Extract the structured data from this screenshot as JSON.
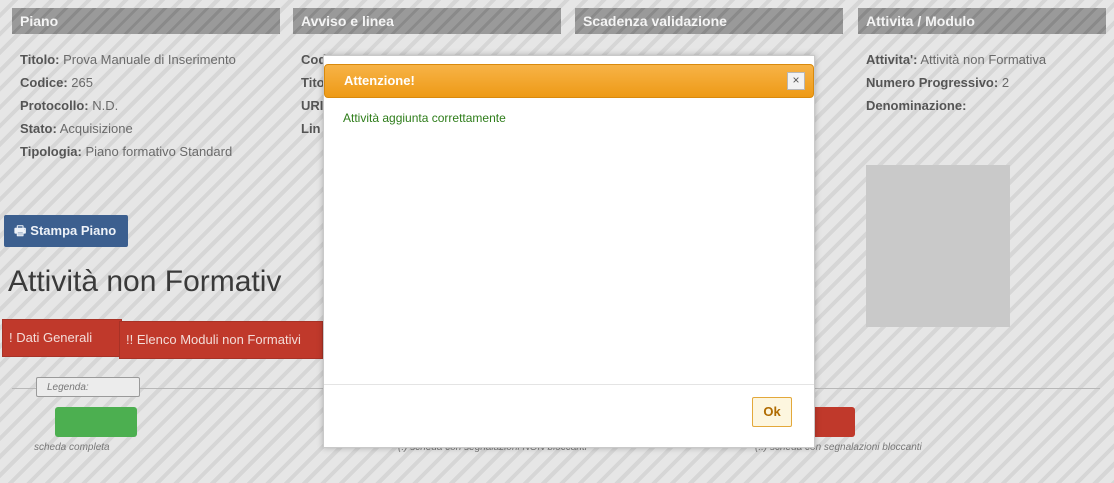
{
  "columns": [
    {
      "title": "Piano",
      "rows": [
        {
          "label": "Titolo:",
          "value": "Prova Manuale di Inserimento"
        },
        {
          "label": "Codice:",
          "value": "265"
        },
        {
          "label": "Protocollo:",
          "value": "N.D."
        },
        {
          "label": "Stato:",
          "value": "Acquisizione"
        },
        {
          "label": "Tipologia:",
          "value": "Piano formativo Standard"
        }
      ]
    },
    {
      "title": "Avviso e linea",
      "rows": [
        {
          "label": "Cod",
          "value": ""
        },
        {
          "label": "Tito",
          "value": ""
        },
        {
          "label": "URI",
          "value": ""
        },
        {
          "label": "Lin",
          "value": ""
        }
      ]
    },
    {
      "title": "Scadenza validazione",
      "rows": []
    },
    {
      "title": "Attivita / Modulo",
      "rows": [
        {
          "label": "Attivita':",
          "value": "Attività non Formativa"
        },
        {
          "label": "Numero Progressivo:",
          "value": "2"
        },
        {
          "label": "Denominazione:",
          "value": ""
        }
      ]
    }
  ],
  "print_button": {
    "label": "Stampa Piano",
    "icon": "printer-icon"
  },
  "section_title": "Attività non Formativ",
  "tabs": [
    {
      "label": "! Dati Generali"
    },
    {
      "label": "!! Elenco Moduli non Formativi"
    }
  ],
  "legend": {
    "title": "Legenda:",
    "items": [
      {
        "text": "scheda completa",
        "color": "#4caf50"
      },
      {
        "text": "(!) scheda con segnalazioni NON bloccanti",
        "color": "#f0ad4e"
      },
      {
        "text": "(!!) scheda con segnalazioni bloccanti",
        "color": "#c0392b"
      }
    ]
  },
  "modal": {
    "title": "Attenzione!",
    "close_symbol": "×",
    "message": "Attività aggiunta correttamente",
    "ok_label": "Ok"
  }
}
